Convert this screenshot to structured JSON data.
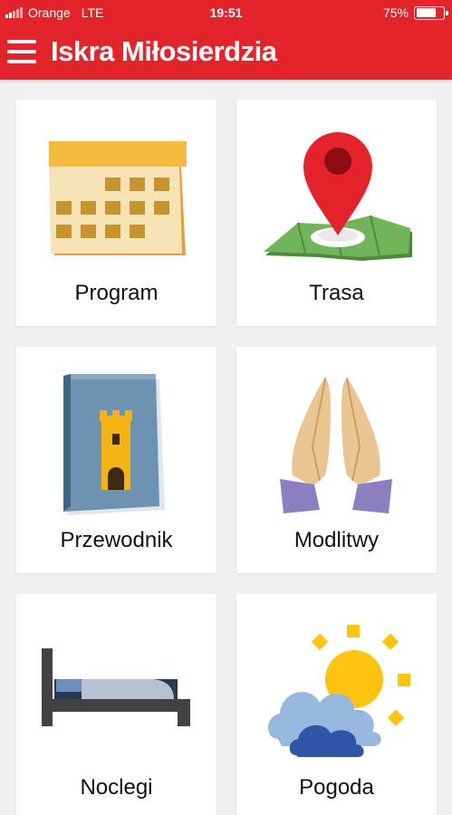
{
  "status_bar": {
    "carrier": "Orange",
    "network": "LTE",
    "time": "19:51",
    "battery_percent": "75%",
    "battery_level": 0.75,
    "signal_bars_active": 2
  },
  "app_bar": {
    "title": "Iskra Miłosierdzia",
    "menu_icon": "hamburger-menu-icon"
  },
  "tiles": [
    {
      "label": "Program",
      "icon": "calendar-icon"
    },
    {
      "label": "Trasa",
      "icon": "map-pin-icon"
    },
    {
      "label": "Przewodnik",
      "icon": "guidebook-tower-icon"
    },
    {
      "label": "Modlitwy",
      "icon": "praying-hands-icon"
    },
    {
      "label": "Noclegi",
      "icon": "bed-icon"
    },
    {
      "label": "Pogoda",
      "icon": "sun-cloud-icon"
    }
  ],
  "colors": {
    "primary": "#e3242b",
    "background": "#f0f0f0",
    "tile": "#ffffff"
  }
}
